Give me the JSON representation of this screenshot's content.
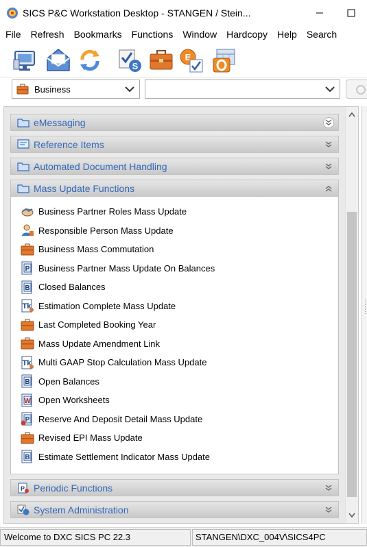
{
  "window": {
    "title": "SICS P&C Workstation Desktop -  STANGEN / Stein...",
    "buttons": [
      "minimize-icon",
      "maximize-icon"
    ]
  },
  "menu": [
    "File",
    "Refresh",
    "Bookmarks",
    "Functions",
    "Window",
    "Hardcopy",
    "Help",
    "Search"
  ],
  "toolbar": {
    "icons": [
      "workstation-icon",
      "messaging-icon",
      "refresh-icon",
      "system-admin-icon",
      "business-briefcase-icon",
      "epi-check-icon",
      "outlook-calendar-icon"
    ]
  },
  "combo": {
    "business_value": "Business",
    "second_value": ""
  },
  "sections": [
    {
      "title": "eMessaging",
      "icon": "folder-icon",
      "state": "collapsed"
    },
    {
      "title": "Reference Items",
      "icon": "reference-icon",
      "state": "collapsed"
    },
    {
      "title": "Automated Document Handling",
      "icon": "folder-icon",
      "state": "collapsed"
    },
    {
      "title": "Mass Update Functions",
      "icon": "folder-icon",
      "state": "expanded"
    },
    {
      "title": "Periodic Functions",
      "icon": "periodic-icon",
      "state": "collapsed"
    },
    {
      "title": "System Administration",
      "icon": "system-admin-icon",
      "state": "collapsed"
    }
  ],
  "mass_update_items": [
    {
      "label": "Business Partner Roles Mass Update",
      "icon": "handshake-icon"
    },
    {
      "label": "Responsible Person Mass Update",
      "icon": "person-icon"
    },
    {
      "label": "Business Mass Commutation",
      "icon": "briefcase-icon"
    },
    {
      "label": "Business Partner Mass Update On Balances",
      "icon": "p-document-icon"
    },
    {
      "label": "Closed Balances",
      "icon": "b-document-icon"
    },
    {
      "label": "Estimation Complete Mass Update",
      "icon": "tk-document-icon"
    },
    {
      "label": "Last Completed Booking Year",
      "icon": "briefcase-icon"
    },
    {
      "label": "Mass Update Amendment Link",
      "icon": "briefcase-icon"
    },
    {
      "label": "Multi GAAP Stop Calculation Mass Update",
      "icon": "tk-document-icon"
    },
    {
      "label": "Open Balances",
      "icon": "b-document-icon"
    },
    {
      "label": "Open Worksheets",
      "icon": "w-document-icon"
    },
    {
      "label": "Reserve And Deposit Detail Mass Update",
      "icon": "p-document-red-icon"
    },
    {
      "label": "Revised EPI Mass Update",
      "icon": "briefcase-icon"
    },
    {
      "label": "Estimate Settlement Indicator Mass Update",
      "icon": "b-document-icon"
    }
  ],
  "status": {
    "left": "Welcome to DXC SICS PC 22.3",
    "right": "STANGEN\\DXC_004V\\SICS4PC"
  },
  "colors": {
    "section_title": "#3268b9",
    "header_gradient_top": "#e6e6e6",
    "header_gradient_bottom": "#c9c9c9"
  }
}
